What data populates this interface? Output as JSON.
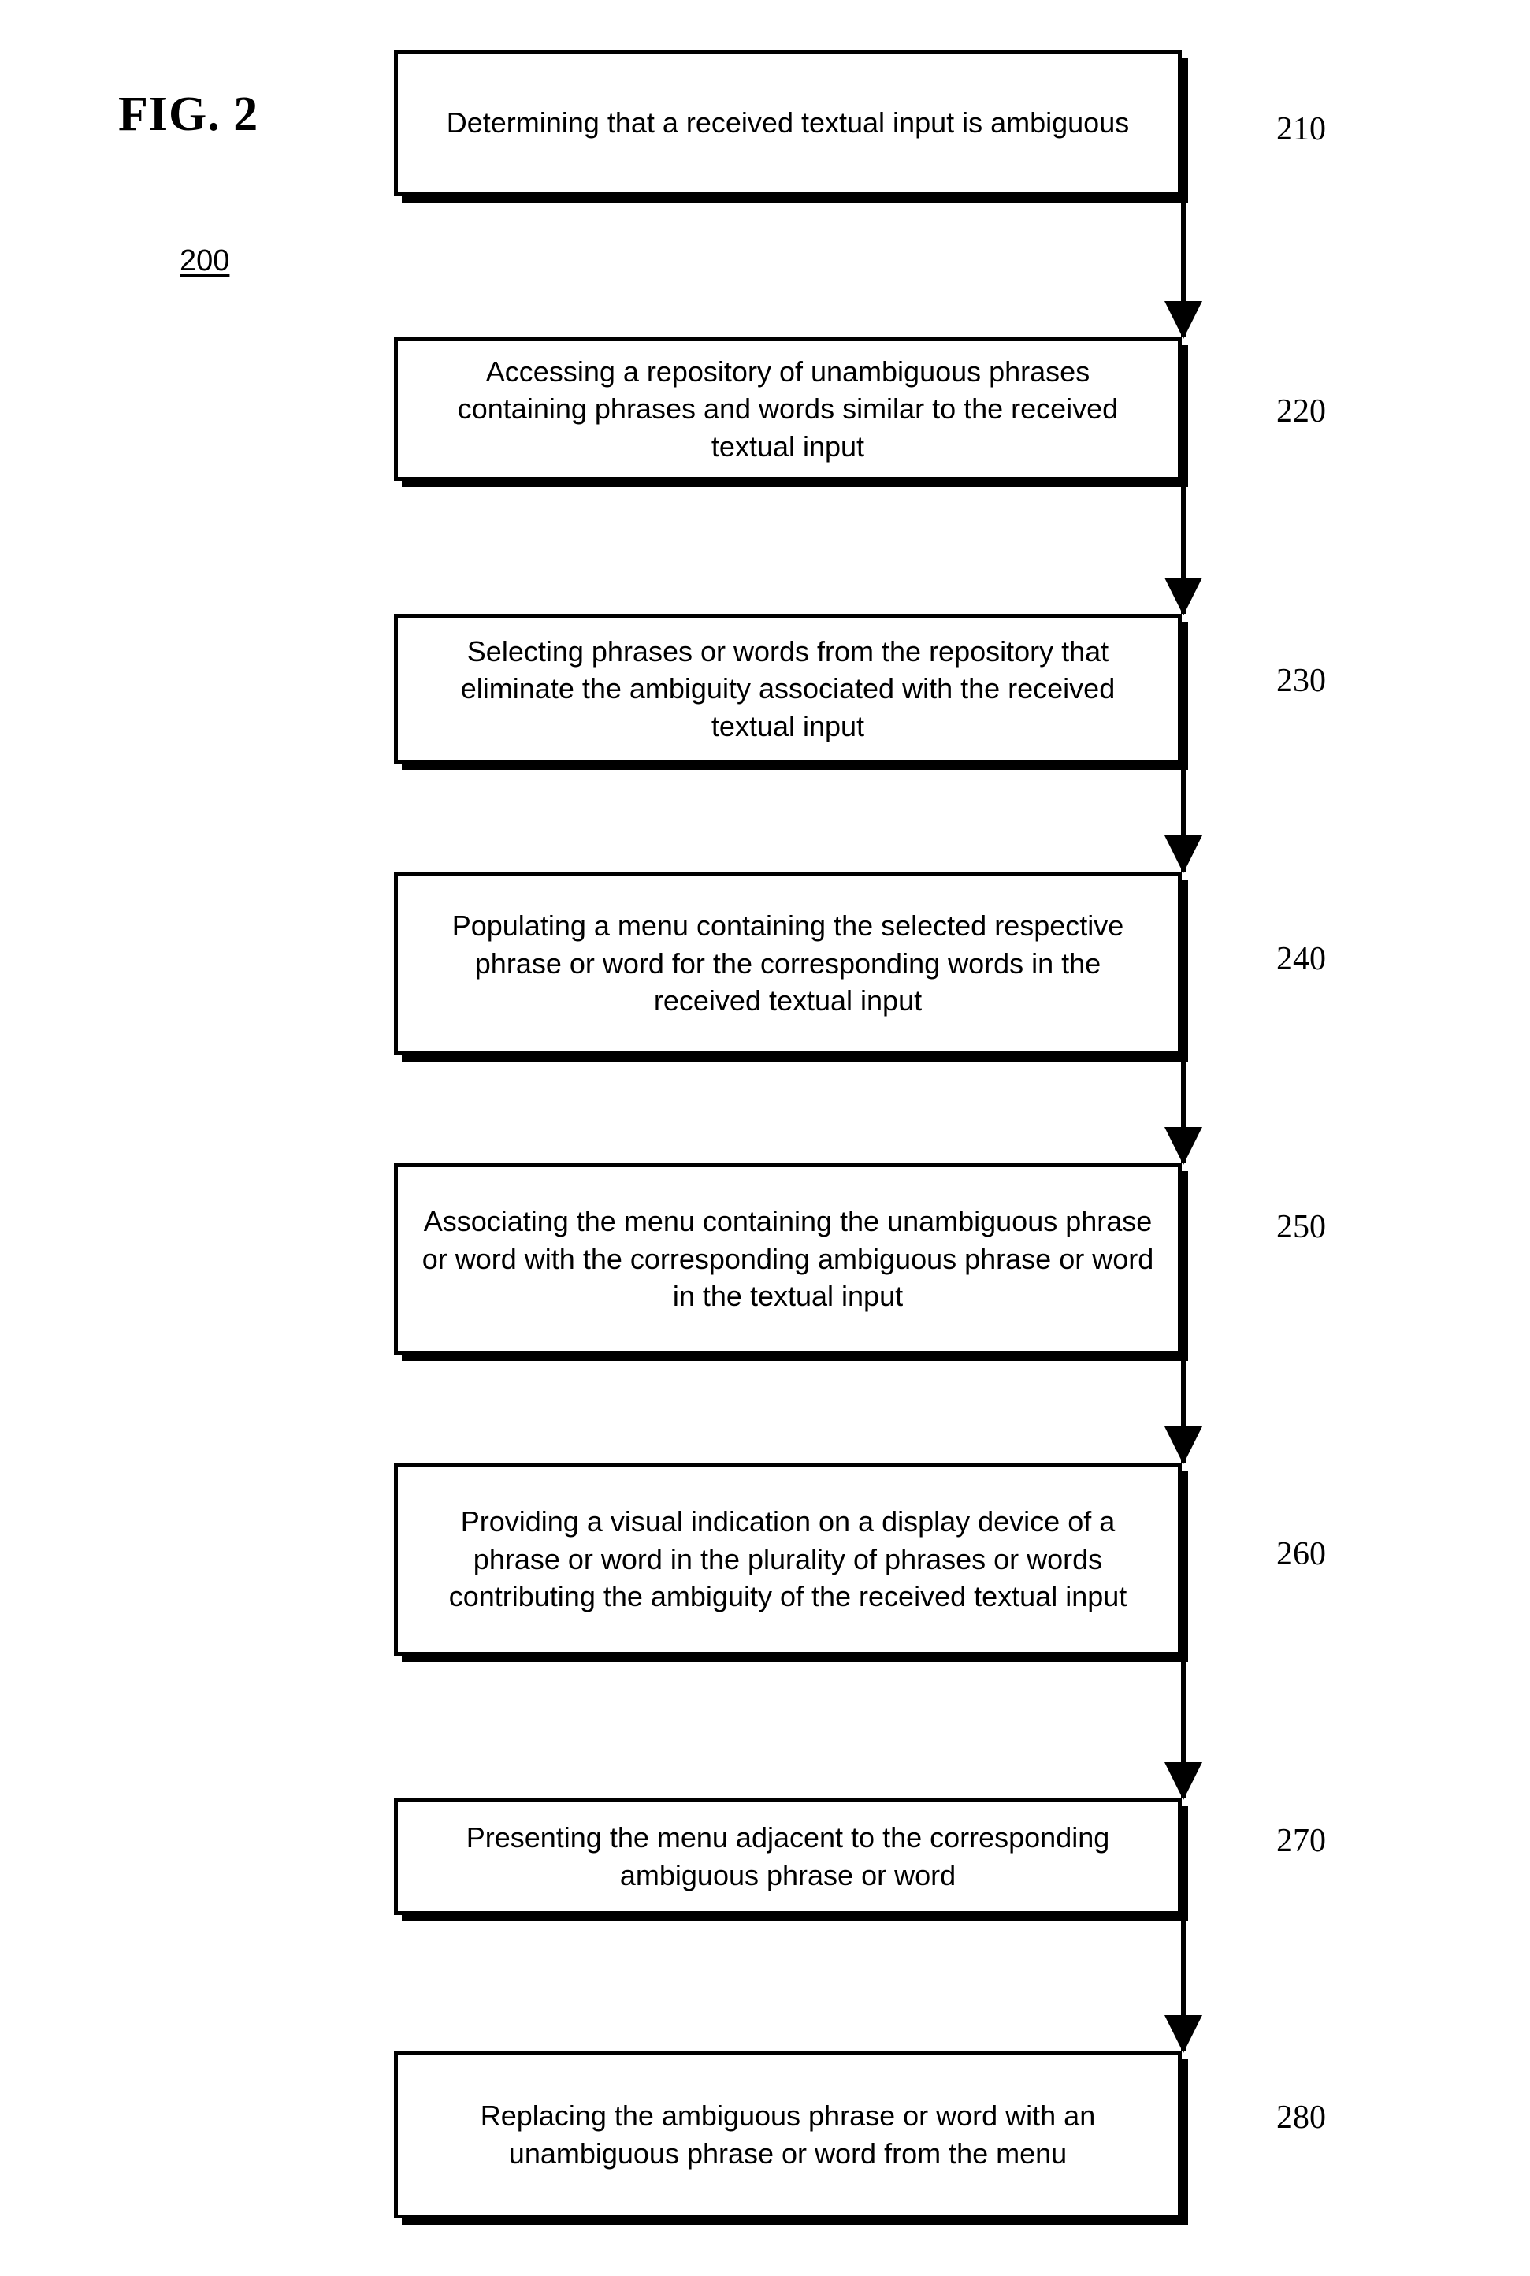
{
  "figure": {
    "label": "FIG. 2",
    "number": "200"
  },
  "flowchart": {
    "type": "flowchart",
    "orientation": "vertical",
    "steps": [
      {
        "ref": "210",
        "text": "Determining that a received textual input is ambiguous"
      },
      {
        "ref": "220",
        "text": "Accessing a repository of unambiguous phrases containing phrases and words similar to the received textual input"
      },
      {
        "ref": "230",
        "text": "Selecting phrases or words from the repository that eliminate the ambiguity associated with the received textual input"
      },
      {
        "ref": "240",
        "text": "Populating a menu containing the selected respective phrase or word for the corresponding words in the received textual input"
      },
      {
        "ref": "250",
        "text": "Associating the menu containing the unambiguous phrase or word with the corresponding ambiguous phrase or word in the textual input"
      },
      {
        "ref": "260",
        "text": "Providing a visual indication on a display device of a phrase or word in the plurality of phrases or words contributing the ambiguity of the received textual input"
      },
      {
        "ref": "270",
        "text": "Presenting the menu adjacent to the corresponding ambiguous phrase or word"
      },
      {
        "ref": "280",
        "text": "Replacing the ambiguous phrase or word with an unambiguous phrase or word from the menu"
      }
    ]
  }
}
